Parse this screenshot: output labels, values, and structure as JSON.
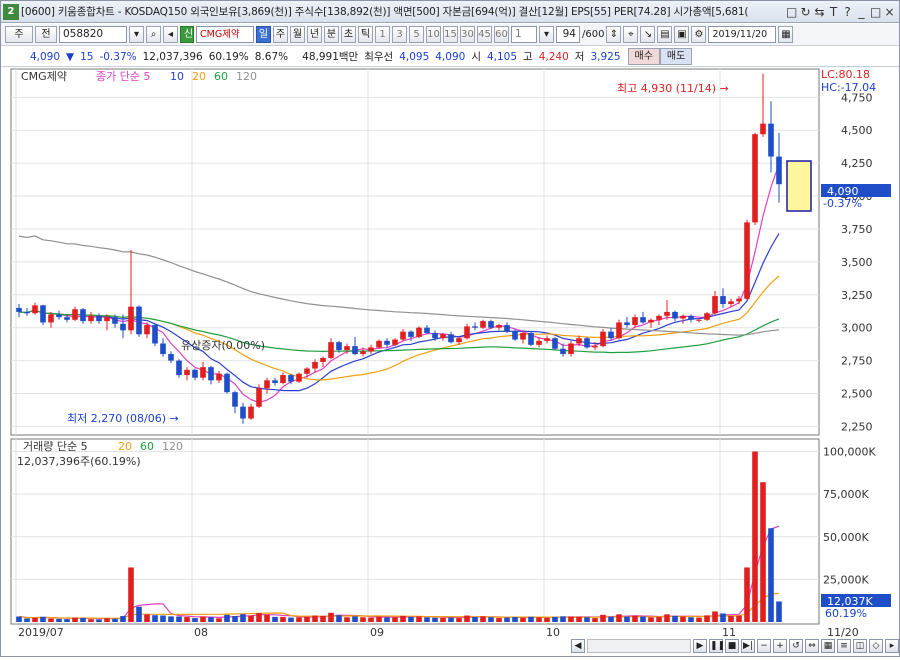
{
  "window": {
    "num": "2",
    "title": "[0600] 키움종합차트 - KOSDAQ150 외국인보유[3,869(천)] 주식수[138,892(천)] 액면[500] 자본금[694(억)] 결산[12월] EPS[55] PER[74.28] 시가총액[5,681(",
    "controls": [
      "□",
      "↻",
      "⇆",
      "T",
      "?",
      "_",
      "□",
      "×"
    ]
  },
  "toolbar": {
    "type": "주",
    "prefix": "전",
    "code": "058820",
    "name": "CMG제약",
    "tag": "신",
    "periods": [
      "일",
      "주",
      "월",
      "년",
      "분",
      "초",
      "틱"
    ],
    "minutes": [
      "1",
      "3",
      "5",
      "10",
      "15",
      "30",
      "45",
      "60"
    ],
    "unit": "1",
    "count": "94",
    "count_total": "/600",
    "date": "2019/11/20"
  },
  "quote": {
    "price": "4,090",
    "change": "15",
    "pct": "-0.37%",
    "volume": "12,037,396",
    "vol_ratio": "60.19%",
    "turnover": "8.67%",
    "amount": "48,991백만",
    "best": "최우선",
    "ask": "4,095",
    "bid": "4,090",
    "open_label": "시",
    "open": "4,105",
    "high_label": "고",
    "high": "4,240",
    "low_label": "저",
    "low": "3,925",
    "buy": "매수",
    "sell": "매도"
  },
  "price_panel": {
    "legend_name": "CMG제약",
    "legend_main": "종가 단순 5",
    "ma": [
      "10",
      "20",
      "60",
      "120"
    ],
    "lc": "LC:80.18",
    "hc": "HC:-17.04",
    "high_note": "최고 4,930 (11/14) →",
    "low_note": "최저 2,270 (08/06) →",
    "event_note": "유상증자(0.00%)",
    "last_price": "4,090",
    "last_pct": "-0.37%",
    "yticks": [
      "4,750",
      "4,500",
      "4,250",
      "4,000",
      "3,750",
      "3,500",
      "3,250",
      "3,000",
      "2,750",
      "2,500",
      "2,250"
    ]
  },
  "vol_panel": {
    "legend_main": "거래량 단순 5",
    "ma": [
      "20",
      "60",
      "120"
    ],
    "info": "12,037,396주(60.19%)",
    "yticks": [
      "100,000K",
      "75,000K",
      "50,000K",
      "25,000K"
    ],
    "last": "12,037K",
    "last_pct": "60.19%"
  },
  "xaxis": {
    "labels": [
      "2019/07",
      "08",
      "09",
      "10",
      "11"
    ],
    "last": "11/20"
  },
  "colors": {
    "up": "#e02020",
    "down": "#1f4ec8",
    "ma5": "#e040c0",
    "ma10": "#2a3fd0",
    "ma20": "#f0a010",
    "ma60": "#20a040",
    "ma120": "#909090"
  },
  "chart_data": {
    "type": "candlestick",
    "ylim": [
      2200,
      4950
    ],
    "vol_ylim": [
      0,
      105000
    ],
    "candles": [
      [
        3150,
        3180,
        3080,
        3120,
        3200
      ],
      [
        3120,
        3150,
        3090,
        3110,
        2100
      ],
      [
        3110,
        3190,
        3100,
        3170,
        2500
      ],
      [
        3170,
        3175,
        3020,
        3040,
        3000
      ],
      [
        3040,
        3120,
        3000,
        3100,
        2000
      ],
      [
        3100,
        3130,
        3060,
        3080,
        1800
      ],
      [
        3080,
        3100,
        3040,
        3060,
        1700
      ],
      [
        3060,
        3160,
        3050,
        3140,
        2600
      ],
      [
        3140,
        3150,
        3030,
        3050,
        2400
      ],
      [
        3050,
        3120,
        3030,
        3090,
        1600
      ],
      [
        3090,
        3110,
        3030,
        3050,
        1500
      ],
      [
        3050,
        3100,
        2980,
        3080,
        2200
      ],
      [
        3080,
        3100,
        3000,
        3030,
        1900
      ],
      [
        3030,
        3100,
        2920,
        2980,
        3500
      ],
      [
        2980,
        3590,
        2950,
        3160,
        32000
      ],
      [
        3160,
        3170,
        2930,
        2950,
        9000
      ],
      [
        2950,
        3040,
        2920,
        3020,
        4500
      ],
      [
        3020,
        3030,
        2860,
        2880,
        4000
      ],
      [
        2880,
        2920,
        2780,
        2800,
        3800
      ],
      [
        2800,
        2820,
        2730,
        2750,
        3300
      ],
      [
        2750,
        2760,
        2620,
        2640,
        3200
      ],
      [
        2640,
        2700,
        2600,
        2680,
        2900
      ],
      [
        2680,
        2690,
        2600,
        2620,
        2300
      ],
      [
        2620,
        2740,
        2600,
        2700,
        3200
      ],
      [
        2700,
        2710,
        2570,
        2600,
        2800
      ],
      [
        2600,
        2670,
        2580,
        2650,
        2200
      ],
      [
        2650,
        2660,
        2500,
        2510,
        4200
      ],
      [
        2510,
        2520,
        2350,
        2400,
        3500
      ],
      [
        2400,
        2430,
        2270,
        2310,
        4600
      ],
      [
        2310,
        2420,
        2300,
        2400,
        3800
      ],
      [
        2400,
        2570,
        2390,
        2540,
        5200
      ],
      [
        2540,
        2620,
        2500,
        2600,
        4400
      ],
      [
        2600,
        2620,
        2560,
        2580,
        3000
      ],
      [
        2580,
        2660,
        2570,
        2640,
        3000
      ],
      [
        2640,
        2650,
        2570,
        2590,
        2600
      ],
      [
        2590,
        2660,
        2580,
        2650,
        2800
      ],
      [
        2650,
        2700,
        2620,
        2690,
        3000
      ],
      [
        2690,
        2760,
        2660,
        2740,
        3800
      ],
      [
        2740,
        2780,
        2700,
        2770,
        3600
      ],
      [
        2770,
        2920,
        2760,
        2890,
        5400
      ],
      [
        2890,
        2900,
        2810,
        2830,
        4000
      ],
      [
        2830,
        2880,
        2800,
        2860,
        2800
      ],
      [
        2860,
        2930,
        2790,
        2800,
        3300
      ],
      [
        2800,
        2850,
        2780,
        2820,
        2800
      ],
      [
        2820,
        2870,
        2800,
        2850,
        2600
      ],
      [
        2850,
        2910,
        2840,
        2900,
        3100
      ],
      [
        2900,
        2920,
        2850,
        2870,
        2700
      ],
      [
        2870,
        2920,
        2860,
        2910,
        2800
      ],
      [
        2910,
        2990,
        2900,
        2970,
        3600
      ],
      [
        2970,
        2980,
        2900,
        2930,
        3000
      ],
      [
        2930,
        3010,
        2920,
        3000,
        3300
      ],
      [
        3000,
        3020,
        2950,
        2960,
        2700
      ],
      [
        2960,
        2980,
        2900,
        2920,
        2500
      ],
      [
        2920,
        2960,
        2900,
        2950,
        2400
      ],
      [
        2950,
        2970,
        2880,
        2890,
        2600
      ],
      [
        2890,
        2930,
        2870,
        2920,
        2300
      ],
      [
        2920,
        3030,
        2910,
        3010,
        3800
      ],
      [
        3010,
        3040,
        2980,
        3000,
        3000
      ],
      [
        3000,
        3060,
        2990,
        3050,
        3300
      ],
      [
        3050,
        3060,
        2990,
        3000,
        2800
      ],
      [
        3000,
        3030,
        2980,
        3020,
        2400
      ],
      [
        3020,
        3040,
        2960,
        2970,
        2600
      ],
      [
        2970,
        2990,
        2900,
        2910,
        2900
      ],
      [
        2910,
        2980,
        2880,
        2960,
        2600
      ],
      [
        2960,
        2970,
        2860,
        2870,
        3100
      ],
      [
        2870,
        2930,
        2850,
        2900,
        2700
      ],
      [
        2900,
        2940,
        2880,
        2920,
        2500
      ],
      [
        2920,
        2930,
        2830,
        2840,
        3000
      ],
      [
        2840,
        2880,
        2780,
        2800,
        3300
      ],
      [
        2800,
        2900,
        2780,
        2880,
        3200
      ],
      [
        2880,
        2940,
        2860,
        2920,
        3000
      ],
      [
        2920,
        2930,
        2840,
        2850,
        2800
      ],
      [
        2850,
        2890,
        2830,
        2860,
        2300
      ],
      [
        2860,
        2990,
        2850,
        2970,
        4200
      ],
      [
        2970,
        3000,
        2900,
        2920,
        3100
      ],
      [
        2920,
        3060,
        2910,
        3040,
        4500
      ],
      [
        3040,
        3080,
        3000,
        3020,
        3200
      ],
      [
        3020,
        3100,
        3000,
        3080,
        3600
      ],
      [
        3080,
        3120,
        3030,
        3040,
        3200
      ],
      [
        3040,
        3070,
        3000,
        3060,
        2700
      ],
      [
        3060,
        3100,
        3020,
        3090,
        3000
      ],
      [
        3090,
        3210,
        3060,
        3120,
        4500
      ],
      [
        3120,
        3130,
        3050,
        3070,
        3600
      ],
      [
        3070,
        3100,
        3030,
        3090,
        3200
      ],
      [
        3090,
        3100,
        3040,
        3060,
        2800
      ],
      [
        3060,
        3070,
        3040,
        3060,
        2600
      ],
      [
        3060,
        3120,
        3050,
        3110,
        3900
      ],
      [
        3110,
        3280,
        3100,
        3240,
        6200
      ],
      [
        3240,
        3300,
        3150,
        3180,
        5000
      ],
      [
        3180,
        3220,
        3160,
        3200,
        3600
      ],
      [
        3200,
        3240,
        3180,
        3220,
        3800
      ],
      [
        3220,
        3820,
        3210,
        3800,
        32000
      ],
      [
        3800,
        4480,
        3780,
        4470,
        100000
      ],
      [
        4470,
        4930,
        4450,
        4550,
        82000
      ],
      [
        4550,
        4720,
        4180,
        4300,
        55000
      ],
      [
        4300,
        4480,
        3950,
        4090,
        12037
      ]
    ],
    "series": [
      {
        "name": "거래량",
        "values": []
      }
    ]
  }
}
